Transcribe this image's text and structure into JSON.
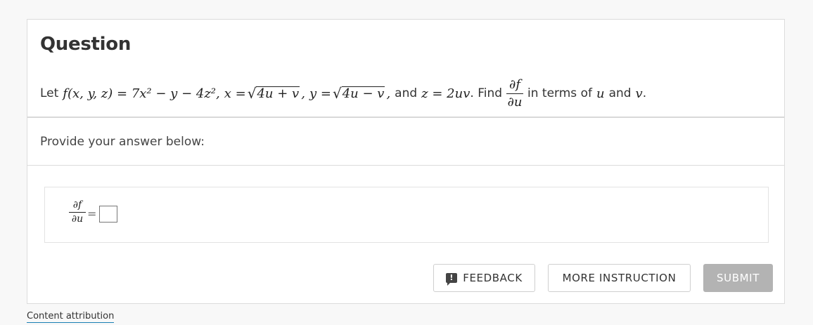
{
  "question": {
    "title": "Question",
    "text_let": "Let",
    "f_def": "f(x, y, z) = 7x² − y − 4z²,",
    "x_eq": "x =",
    "x_rad": "4u + v",
    "comma1": ",",
    "y_eq": "y =",
    "y_rad": "4u − v",
    "comma2": ",",
    "and": "and",
    "z_def": "z = 2uv",
    "find": ". Find",
    "frac_num": "∂f",
    "frac_den": "∂u",
    "in_terms": "in terms of",
    "u": "u",
    "and2": "and",
    "v": "v",
    "period": "."
  },
  "prompt": {
    "text": "Provide your answer below:"
  },
  "answer": {
    "frac_num": "∂f",
    "frac_den": "∂u",
    "equals": "=",
    "value": ""
  },
  "buttons": {
    "feedback": "FEEDBACK",
    "feedback_icon": "!",
    "more": "MORE INSTRUCTION",
    "submit": "SUBMIT"
  },
  "footer": {
    "attribution": "Content attribution"
  }
}
